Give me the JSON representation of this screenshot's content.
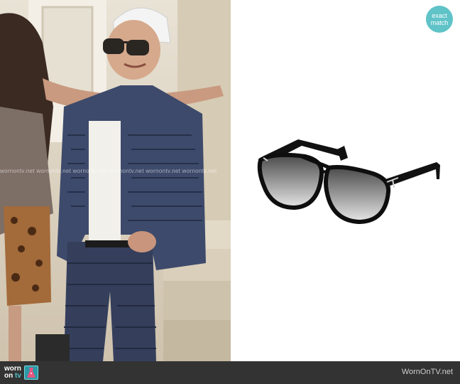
{
  "badge": {
    "line1": "exact",
    "line2": "match",
    "color": "#5fc3c8"
  },
  "watermark": {
    "text": "wornontv.net  wornontv.net  wornontv.net  wornontv.net  wornontv.net  wornontv.net"
  },
  "footer": {
    "logo_line1": "worn",
    "logo_line2": "on",
    "logo_tv": "tv",
    "site": "WornOnTV.net",
    "background": "#333333",
    "accent": "#4ec3cf"
  },
  "icons": {
    "logo": "dress-icon",
    "product": "aviator-sunglasses"
  }
}
